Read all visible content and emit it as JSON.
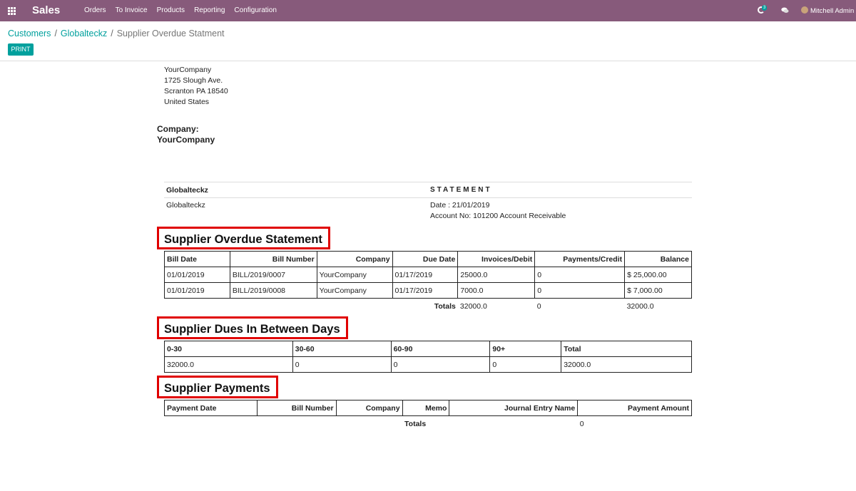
{
  "navbar": {
    "brand": "Sales",
    "menu": [
      "Orders",
      "To Invoice",
      "Products",
      "Reporting",
      "Configuration"
    ],
    "activity_count": "3",
    "user_name": "Mitchell Admin"
  },
  "breadcrumb": {
    "items": [
      "Customers",
      "Globalteckz"
    ],
    "current": "Supplier Overdue Statment"
  },
  "buttons": {
    "print": "PRINT"
  },
  "address": {
    "line1": "YourCompany",
    "line2": "1725 Slough Ave.",
    "line3": "Scranton PA 18540",
    "line4": "United States"
  },
  "company": {
    "label": "Company:",
    "name": "YourCompany"
  },
  "statement": {
    "partner": "Globalteckz",
    "title": "STATEMENT",
    "partner_detail": "Globalteckz",
    "date": "Date : 21/01/2019",
    "account": "Account No: 101200   Account Receivable"
  },
  "overdue": {
    "title": "Supplier Overdue Statement",
    "headers": [
      "Bill Date",
      "Bill Number",
      "Company",
      "Due Date",
      "Invoices/Debit",
      "Payments/Credit",
      "Balance"
    ],
    "rows": [
      [
        "01/01/2019",
        "BILL/2019/0007",
        "YourCompany",
        "01/17/2019",
        "25000.0",
        "0",
        "$ 25,000.00"
      ],
      [
        "01/01/2019",
        "BILL/2019/0008",
        "YourCompany",
        "01/17/2019",
        "7000.0",
        "0",
        "$ 7,000.00"
      ]
    ],
    "totals_label": "Totals",
    "totals": [
      "32000.0",
      "0",
      "32000.0"
    ]
  },
  "dues": {
    "title": "Supplier Dues In Between Days",
    "headers": [
      "0-30",
      "30-60",
      "60-90",
      "90+",
      "Total"
    ],
    "row": [
      "32000.0",
      "0",
      "0",
      "0",
      "32000.0"
    ]
  },
  "payments": {
    "title": "Supplier Payments",
    "headers": [
      "Payment Date",
      "Bill Number",
      "Company",
      "Memo",
      "Journal Entry Name",
      "Payment Amount"
    ],
    "totals_label": "Totals",
    "total": "0"
  },
  "colors": {
    "navbar": "#875a7b",
    "accent": "#00a09d",
    "highlight": "#e00000"
  }
}
